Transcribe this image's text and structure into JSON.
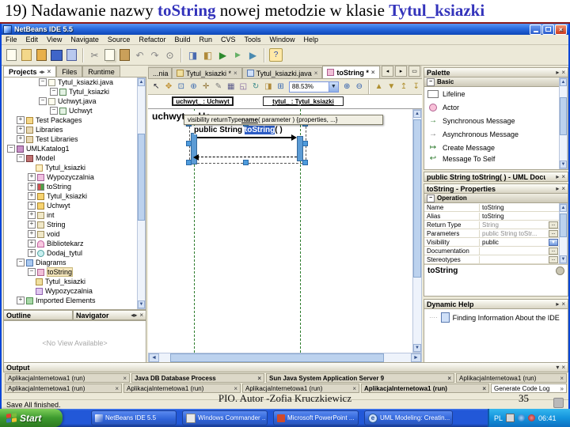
{
  "slide": {
    "title": {
      "part1": "19) Nadawanie nazwy ",
      "link1": "toString",
      "part2": " nowej metodzie w klasie ",
      "link2": "Tytul_ksiazki"
    },
    "footer": "PIO.  Autor -Zofia Kruczkiewicz",
    "page_number": "35",
    "accent_color": "#3333bb"
  },
  "window": {
    "title": "NetBeans IDE 5.5"
  },
  "menu": {
    "items": [
      "File",
      "Edit",
      "View",
      "Navigate",
      "Source",
      "Refactor",
      "Build",
      "Run",
      "CVS",
      "Tools",
      "Window",
      "Help"
    ]
  },
  "left": {
    "tabs": [
      "Projects",
      "Files",
      "Runtime"
    ],
    "tree": [
      {
        "label": "Tytul_ksiazki.java"
      },
      {
        "label": "Tytul_ksiazki"
      },
      {
        "label": "Uchwyt.java"
      },
      {
        "label": "Uchwyt"
      },
      {
        "label": "Test Packages"
      },
      {
        "label": "Libraries"
      },
      {
        "label": "Test Libraries"
      },
      {
        "label": "UMLKatalog1"
      },
      {
        "label": "Model"
      },
      {
        "label": "Tytul_ksiazki"
      },
      {
        "label": "Wypozyczalnia"
      },
      {
        "label": "toString"
      },
      {
        "label": "Tytul_ksiazki"
      },
      {
        "label": "Uchwyt"
      },
      {
        "label": "int"
      },
      {
        "label": "String"
      },
      {
        "label": "void"
      },
      {
        "label": "Bibliotekarz"
      },
      {
        "label": "Dodaj_tytul"
      },
      {
        "label": "Diagrams"
      },
      {
        "label": "toString"
      },
      {
        "label": "Tytul_ksiazki"
      },
      {
        "label": "Wypozyczalnia"
      },
      {
        "label": "Imported Elements"
      }
    ],
    "bottom": {
      "outline": "Outline",
      "navigator": "Navigator",
      "empty": "<No View Available>"
    }
  },
  "editor": {
    "tabs": [
      {
        "label": "...nia"
      },
      {
        "label": "Tytul_ksiazki *"
      },
      {
        "label": "Tytul_ksiazki.java"
      },
      {
        "label": "toString *"
      }
    ],
    "zoom_value": "88.53%",
    "heads": [
      {
        "label": "uchwyt_ : Uchwyt"
      },
      {
        "label": "tytul_ : Tytul_ksiazki"
      }
    ],
    "clipped_label": "uchwyt_ : Uc",
    "hint": {
      "pre": "visibility returnType ",
      "name": "name",
      "post": "( parameter ) {properties, ...}"
    },
    "message": {
      "pre": "public String ",
      "selected": "toString",
      "post": "( )"
    }
  },
  "palette": {
    "title": "Palette",
    "group": "Basic",
    "items": [
      {
        "label": "Lifeline"
      },
      {
        "label": "Actor"
      },
      {
        "label": "Synchronous Message"
      },
      {
        "label": "Asynchronous Message"
      },
      {
        "label": "Create Message"
      },
      {
        "label": "Message To Self"
      }
    ]
  },
  "docpanel": {
    "title": "public String toString( ) - UML Docu..."
  },
  "props": {
    "title": "toString - Properties",
    "group": "Operation",
    "rows": [
      {
        "label": "Name",
        "value": "toString"
      },
      {
        "label": "Alias",
        "value": "toString"
      },
      {
        "label": "Return Type",
        "value": "String"
      },
      {
        "label": "Parameters",
        "value": "public String toStr..."
      },
      {
        "label": "Visibility",
        "value": "public"
      },
      {
        "label": "Documentation",
        "value": ""
      },
      {
        "label": "Stereotypes",
        "value": ""
      }
    ],
    "selected_element": "toString"
  },
  "dynhelp": {
    "title": "Dynamic Help",
    "item": "Finding Information About the IDE"
  },
  "output": {
    "title": "Output",
    "row1": [
      {
        "label": "AplikacjaInternetowa1 (run)"
      },
      {
        "label": "Java DB Database Process"
      },
      {
        "label": "Sun Java System Application Server 9"
      },
      {
        "label": "AplikacjaInternetowa1 (run)"
      }
    ],
    "row2": [
      {
        "label": "AplikacjaInternetowa1 (run)"
      },
      {
        "label": "AplikacjaInternetowa1 (run)"
      },
      {
        "label": "AplikacjaInternetowa1 (run)"
      },
      {
        "label": "AplikacjaInternetowa1 (run)"
      },
      {
        "label": "Generate Code Log"
      }
    ]
  },
  "status": {
    "text": "Save All finished."
  },
  "taskbar": {
    "start_label": "Start",
    "tasks": [
      {
        "label": "NetBeans IDE 5.5"
      },
      {
        "label": "Windows Commander .."
      },
      {
        "label": "Microsoft PowerPoint ..."
      },
      {
        "label": "UML Modeling: Creatin..."
      }
    ],
    "tray_lang": "PL",
    "time": "06:41"
  }
}
